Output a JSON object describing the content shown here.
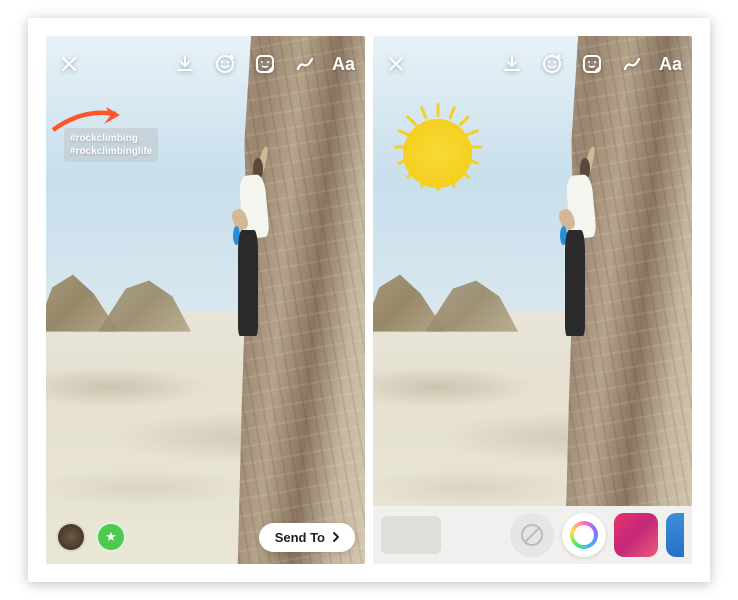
{
  "annotation": {
    "arrow_color": "#ff5528"
  },
  "left": {
    "toolbar": {
      "close": "close",
      "download": "download",
      "face_filter": "face-filter",
      "sticker": "sticker",
      "draw": "draw",
      "text_label": "Aa"
    },
    "hashtags": {
      "line1": "#rockclimbing",
      "line2": "#rockclimbinglife"
    },
    "bottom": {
      "story_avatar": "your-story",
      "close_friends": "close-friends",
      "send_to_label": "Send To"
    }
  },
  "right": {
    "toolbar": {
      "close": "close",
      "download": "download",
      "face_filter": "face-filter",
      "sticker": "sticker",
      "draw": "draw",
      "text_label": "Aa"
    },
    "sticker": {
      "name": "sun",
      "color": "#f5d020"
    },
    "bottom": {
      "pen_none": "no-pen",
      "pen_rainbow": "rainbow-pen",
      "pen_magenta": "magenta-pen",
      "pen_blue": "blue-pen"
    }
  }
}
